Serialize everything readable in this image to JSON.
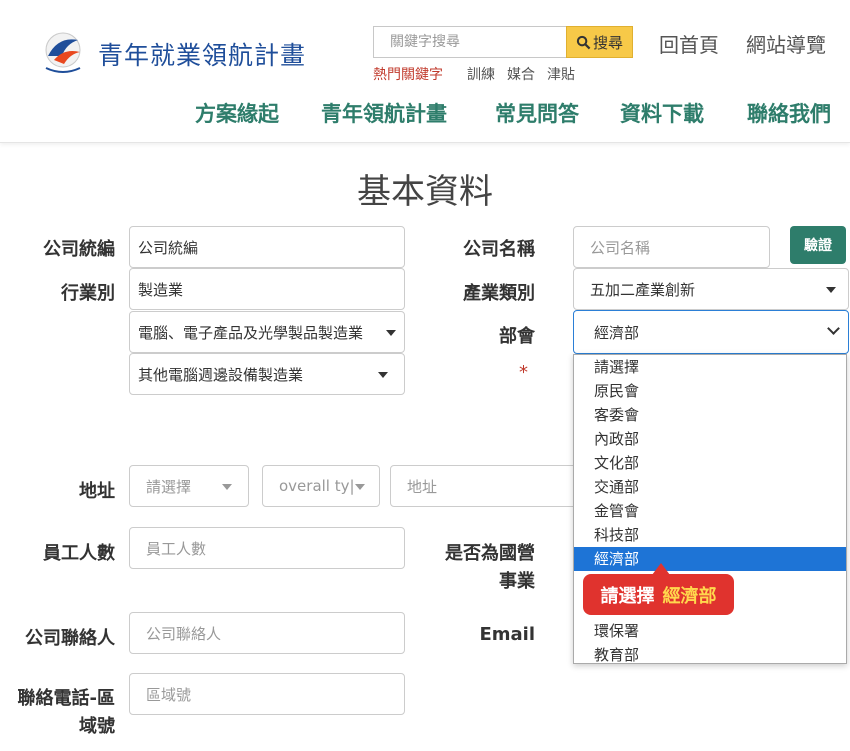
{
  "header": {
    "site_title": "青年就業領航計畫",
    "search": {
      "placeholder": "關鍵字搜尋",
      "button_label": "搜尋"
    },
    "hot_keywords_label": "熱門關鍵字",
    "hot_keywords": [
      "訓練",
      "媒合",
      "津貼"
    ],
    "top_links": [
      "回首頁",
      "網站導覽"
    ],
    "nav": [
      "方案緣起",
      "青年領航計畫",
      "常見問答",
      "資料下載",
      "聯絡我們"
    ]
  },
  "form": {
    "title": "基本資料",
    "company_id": {
      "label": "公司統編",
      "value": "公司統編"
    },
    "company_name": {
      "label": "公司名稱",
      "placeholder": "公司名稱"
    },
    "verify_button": "驗證",
    "industry": {
      "label": "行業別",
      "value": "製造業",
      "sub1": "電腦、電子產品及光學製品製造業",
      "sub2": "其他電腦週邊設備製造業"
    },
    "industry_category": {
      "label": "產業類別",
      "value": "五加二產業創新"
    },
    "ministry": {
      "label": "部會",
      "value": "經濟部",
      "options": [
        "請選擇",
        "原民會",
        "客委會",
        "內政部",
        "文化部",
        "交通部",
        "金管會",
        "科技部",
        "經濟部",
        "",
        "",
        "環保署",
        "教育部"
      ],
      "selected_index": 8
    },
    "required_mark": "*",
    "address": {
      "label": "地址",
      "city_placeholder": "請選擇",
      "district_placeholder": "overall ty|",
      "placeholder": "地址"
    },
    "employees": {
      "label": "員工人數",
      "placeholder": "員工人數"
    },
    "state_owned": {
      "label_line1": "是否為國營",
      "label_line2": "事業"
    },
    "contact": {
      "label": "公司聯絡人",
      "placeholder": "公司聯絡人"
    },
    "email": {
      "label": "Email"
    },
    "phone_area": {
      "label_line1": "聯絡電話-區",
      "label_line2": "域號",
      "placeholder": "區域號"
    }
  },
  "tooltip": {
    "prefix": "請選擇",
    "highlight": "經濟部"
  },
  "colors": {
    "accent_green": "#2e7d6b",
    "select_blue": "#1e74d6",
    "tooltip_red": "#e0332e",
    "search_yellow": "#f7c948"
  }
}
